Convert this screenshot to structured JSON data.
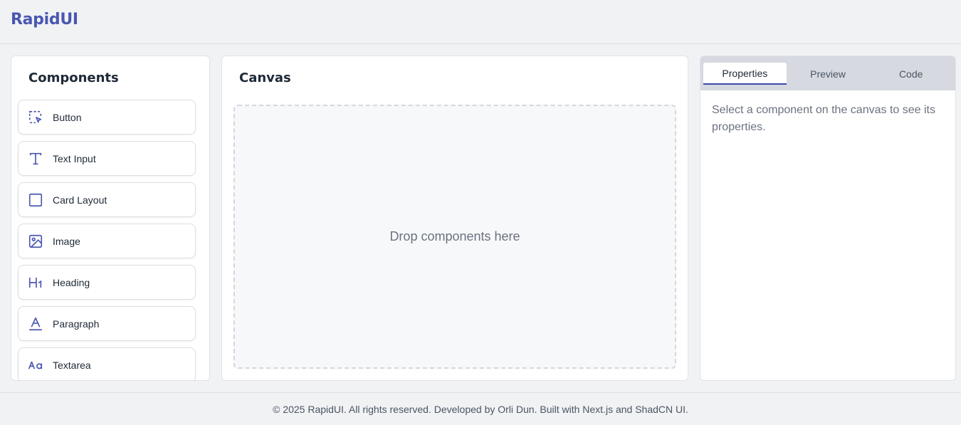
{
  "header": {
    "brand": "RapidUI"
  },
  "components_panel": {
    "title": "Components",
    "items": [
      {
        "label": "Button",
        "icon": "cursor-select-icon"
      },
      {
        "label": "Text Input",
        "icon": "text-type-icon"
      },
      {
        "label": "Card Layout",
        "icon": "square-icon"
      },
      {
        "label": "Image",
        "icon": "image-icon"
      },
      {
        "label": "Heading",
        "icon": "heading1-icon"
      },
      {
        "label": "Paragraph",
        "icon": "paragraph-letter-icon"
      },
      {
        "label": "Textarea",
        "icon": "case-sensitive-icon"
      }
    ]
  },
  "canvas": {
    "title": "Canvas",
    "placeholder": "Drop components here"
  },
  "properties_panel": {
    "tabs": [
      {
        "label": "Properties",
        "active": true
      },
      {
        "label": "Preview",
        "active": false
      },
      {
        "label": "Code",
        "active": false
      }
    ],
    "empty_message": "Select a component on the canvas to see its properties."
  },
  "footer": {
    "text": "© 2025 RapidUI. All rights reserved. Developed by Orli Dun. Built with Next.js and ShadCN UI."
  },
  "colors": {
    "brand": "#4a57b0",
    "accent": "#3b4aa8",
    "background": "#f1f2f4"
  }
}
